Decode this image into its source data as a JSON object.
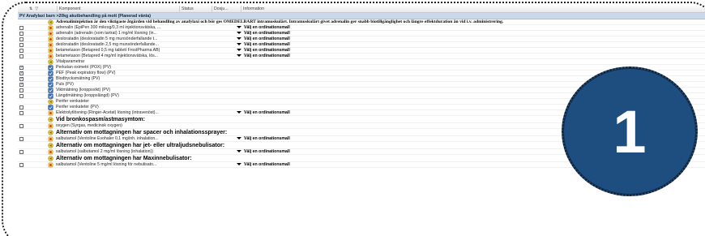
{
  "header": {
    "komponent": "Komponent",
    "status": "Status",
    "dosering": "Dosju...",
    "information": "Information"
  },
  "group_title": "PV Anafylaxi barn >20kg akutbehandling på mott (Planerad vänta)",
  "select_label": "Välj en ordinationsmall",
  "callout_number": "1",
  "rows": [
    {
      "label": "Adrenalininjektion är den viktigaste åtgärden vid behandling av anafylaxi och bör ges OMEDELBART intramuskulärt. Intramuskulärt givet adrenalin ger snabb biotillgänglighet och längre effektduration än vid i.v. administrering.",
      "kind": "note",
      "checkbox": false,
      "checked": false,
      "icon": "info-icon"
    },
    {
      "label": "adrenalin (EpiPen 300 mikrog/0,3 ml injektionsvätska, ...",
      "kind": "med",
      "checkbox": true,
      "checked": false,
      "icon": "medication-icon",
      "select": true
    },
    {
      "label": "adrenalin (adrenalin (som tartrat) 1 mg/ml lösning (in...",
      "kind": "med",
      "checkbox": true,
      "checked": false,
      "icon": "medication-icon",
      "select": true
    },
    {
      "label": "desloratadin (desloratadin 5 mg munsönderfallande t...",
      "kind": "med",
      "checkbox": true,
      "checked": false,
      "icon": "medication-icon",
      "select": true
    },
    {
      "label": "desloratadin (desloratadin 2,5 mg munsönderfallande...",
      "kind": "med",
      "checkbox": true,
      "checked": false,
      "icon": "medication-icon",
      "select": true
    },
    {
      "label": "betametason (Betapred 0,5 mg tablett FrostPharma AB)",
      "kind": "med",
      "checkbox": true,
      "checked": false,
      "icon": "medication-icon",
      "select": true
    },
    {
      "label": "betametason (Betapred 4 mg/ml injektionsvätska, lös...",
      "kind": "med",
      "checkbox": true,
      "checked": false,
      "icon": "medication-icon",
      "select": true
    },
    {
      "label": "Vitalparametrar",
      "kind": "section",
      "checkbox": false,
      "checked": false,
      "icon": "info-icon"
    },
    {
      "label": "Perkutan oximetri (POX) (PV)",
      "kind": "task",
      "checkbox": true,
      "checked": true,
      "icon": "task-icon"
    },
    {
      "label": "PEF (Peak expiratory flow) (PV)",
      "kind": "task",
      "checkbox": true,
      "checked": true,
      "icon": "task-icon"
    },
    {
      "label": "Blodtrycksmätning (PV)",
      "kind": "task",
      "checkbox": true,
      "checked": true,
      "icon": "task-icon"
    },
    {
      "label": "Puls (PV)",
      "kind": "task",
      "checkbox": true,
      "checked": true,
      "icon": "task-icon"
    },
    {
      "label": "Viktmätning (kroppsvikt) (PV)",
      "kind": "task",
      "checkbox": true,
      "checked": false,
      "icon": "task-icon"
    },
    {
      "label": "Längdmätning (kroppslängd) (PV)",
      "kind": "task",
      "checkbox": true,
      "checked": false,
      "icon": "task-icon"
    },
    {
      "label": "Perifer venkateter",
      "kind": "section",
      "checkbox": false,
      "checked": false,
      "icon": "info-icon"
    },
    {
      "label": "Perifer venkateter (PV)",
      "kind": "task",
      "checkbox": true,
      "checked": false,
      "icon": "task-icon"
    },
    {
      "label": "Elektrolytlösning (Ringer-Acetat) lösning (intravenöst)...",
      "kind": "med",
      "checkbox": true,
      "checked": false,
      "icon": "medication-icon",
      "select": true
    },
    {
      "label": "Vid bronkospasm/astmasymtom:",
      "kind": "big",
      "checkbox": false,
      "checked": false,
      "icon": "info-icon"
    },
    {
      "label": "oxygen (Syrgas, medicinsk oxygen)",
      "kind": "med",
      "checkbox": true,
      "checked": false,
      "icon": "medication-icon"
    },
    {
      "label": "Alternativ om mottagningen har spacer och inhalationssprayer:",
      "kind": "big",
      "checkbox": false,
      "checked": false,
      "icon": "info-icon"
    },
    {
      "label": "salbutamol (Ventoline Evohaler 0,1 mg/inh. inhalation...",
      "kind": "med",
      "checkbox": true,
      "checked": false,
      "icon": "medication-icon",
      "select": true
    },
    {
      "label": "Alternativ om mottagningen har jet- eller ultraljudsnebulisator:",
      "kind": "big",
      "checkbox": false,
      "checked": false,
      "icon": "info-icon"
    },
    {
      "label": "salbutamol (salbutamol 2 mg/ml lösning (inhalation))",
      "kind": "med",
      "checkbox": true,
      "checked": false,
      "icon": "medication-icon",
      "select": true
    },
    {
      "label": "Alternativ om mottagningen har  Maxinnebulisator:",
      "kind": "big",
      "checkbox": false,
      "checked": false,
      "icon": "info-icon"
    },
    {
      "label": "salbutamol (Ventoline 5 mg/ml lösning för nebulisato...",
      "kind": "med",
      "checkbox": true,
      "checked": false,
      "icon": "medication-icon",
      "select": true
    }
  ]
}
